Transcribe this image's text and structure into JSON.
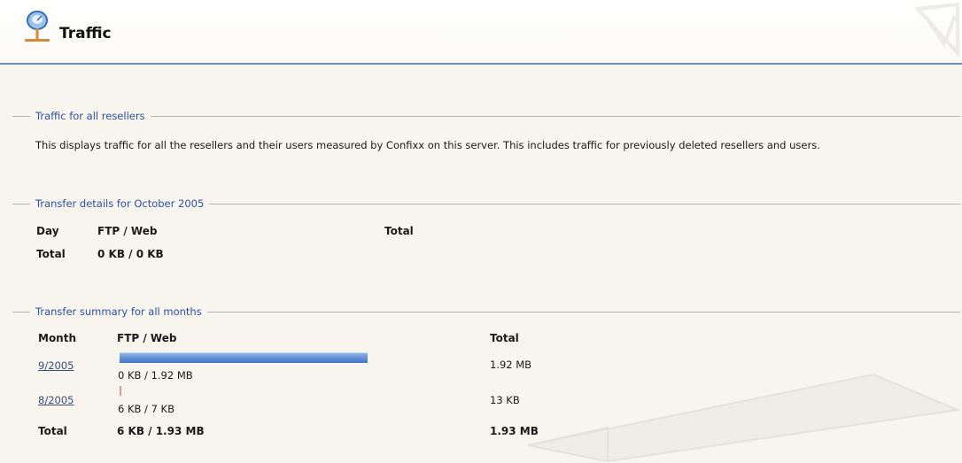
{
  "header": {
    "title": "Traffic",
    "icon": "satellite-dish-icon"
  },
  "sections": {
    "resellers": {
      "legend": "Traffic for all resellers",
      "description": "This displays traffic for all the resellers and their users measured by Confixx on this server. This includes traffic for previously deleted resellers and users."
    },
    "details": {
      "legend": "Transfer details for October 2005",
      "columns": {
        "day": "Day",
        "ftp_web": "FTP / Web",
        "total": "Total"
      },
      "total_row": {
        "label": "Total",
        "ftp_web": "0 KB / 0 KB"
      }
    },
    "summary": {
      "legend": "Transfer summary for all months",
      "columns": {
        "month": "Month",
        "ftp_web": "FTP / Web",
        "total": "Total"
      },
      "rows": [
        {
          "month": "9/2005",
          "ftp_web": "0 KB / 1.92 MB",
          "total": "1.92 MB",
          "bar_fraction": 1.0
        },
        {
          "month": "8/2005",
          "ftp_web": "6 KB / 7 KB",
          "total": "13 KB",
          "bar_fraction": 0.007
        }
      ],
      "total_row": {
        "label": "Total",
        "ftp_web": "6 KB / 1.93 MB",
        "total": "1.93 MB"
      }
    }
  },
  "colors": {
    "accent": "#5f8fd4",
    "legend_text": "#2a50a8",
    "bar": "#5b8bd3"
  }
}
